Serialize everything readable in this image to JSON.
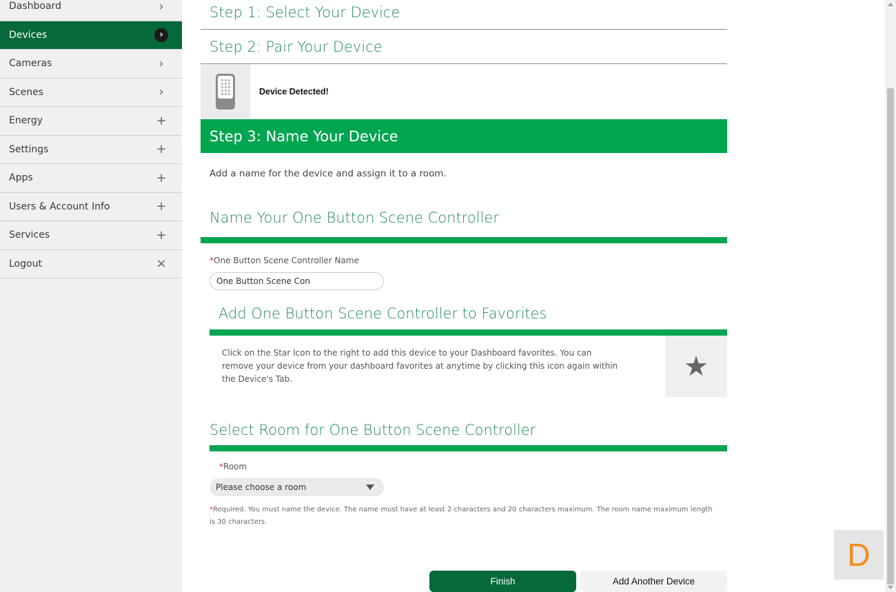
{
  "sidebar": {
    "items": [
      {
        "label": "Dashboard",
        "icon": "chevron-right-icon",
        "glyph": "›"
      },
      {
        "label": "Devices",
        "icon": "chevron-right-icon",
        "glyph": "›"
      },
      {
        "label": "Cameras",
        "icon": "chevron-right-icon",
        "glyph": "›"
      },
      {
        "label": "Scenes",
        "icon": "chevron-right-icon",
        "glyph": "›"
      },
      {
        "label": "Energy",
        "icon": "plus-icon",
        "glyph": "+"
      },
      {
        "label": "Settings",
        "icon": "plus-icon",
        "glyph": "+"
      },
      {
        "label": "Apps",
        "icon": "plus-icon",
        "glyph": "+"
      },
      {
        "label": "Users & Account Info",
        "icon": "plus-icon",
        "glyph": "+"
      },
      {
        "label": "Services",
        "icon": "plus-icon",
        "glyph": "+"
      },
      {
        "label": "Logout",
        "icon": "close-icon",
        "glyph": "×"
      }
    ],
    "active_item": "Devices"
  },
  "steps": {
    "step1": "Step 1: Select Your Device",
    "step2": "Step 2: Pair Your Device",
    "detected": "Device Detected!",
    "step3": "Step 3: Name Your Device",
    "intro": "Add a name for the device and assign it to a room."
  },
  "name_section": {
    "title": "Name Your One Button Scene Controller",
    "required_mark": "*",
    "label": "One Button Scene Controller Name",
    "value": "One Button Scene Con"
  },
  "favorites": {
    "title": "Add One Button Scene Controller to Favorites",
    "text": "Click on the Star Icon to the right to add this device to your Dashboard favorites. You can remove your device from your dashboard favorites at anytime by clicking this icon again within the Device's Tab.",
    "star_glyph": "★"
  },
  "room_section": {
    "title": "Select Room for One Button Scene Controller",
    "required_mark": "*",
    "label": "Room",
    "selected": "Please choose a room",
    "note_mark": "*",
    "note": "Required. You must name the device. The name must have at least 2 characters and 20 characters maximum. The room name maximum length is 30 characters."
  },
  "actions": {
    "finish": "Finish",
    "add_another": "Add Another Device"
  },
  "widget": {
    "letter": "D"
  },
  "colors": {
    "primary_dark_green": "#05693a",
    "accent_green": "#00a550",
    "heading_green": "#1f8a55",
    "required_red": "#d9302c",
    "widget_orange": "#f28c1a"
  }
}
